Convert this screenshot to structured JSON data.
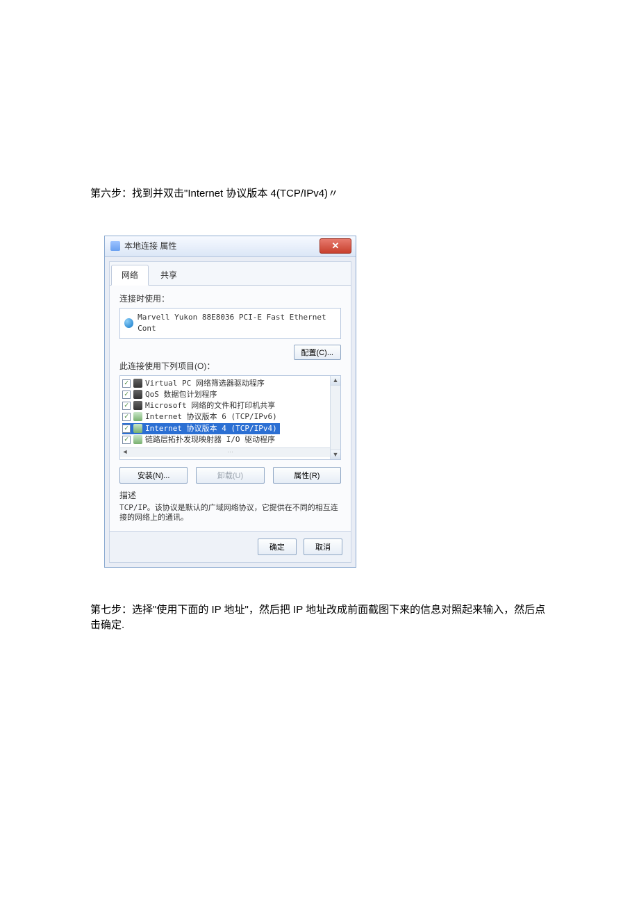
{
  "step6_text": "第六步：找到并双击\"Internet 协议版本 4(TCP/IPv4)〃",
  "step7_text": "第七步：选择\"使用下面的 IP 地址\"，然后把 IP 地址改成前面截图下来的信息对照起来输入，然后点击确定.",
  "dialog": {
    "title": "本地连接 属性",
    "close_label": "✕",
    "tabs": {
      "network": "网络",
      "share": "共享"
    },
    "connect_label": "连接时使用：",
    "adapter": "Marvell Yukon 88E8036 PCI-E Fast Ethernet Cont",
    "configure_btn": "配置(C)...",
    "items_label": "此连接使用下列项目(O)：",
    "items": [
      {
        "label": "Virtual PC 网络筛选器驱动程序",
        "iconClass": "mon",
        "selected": false
      },
      {
        "label": "QoS 数据包计划程序",
        "iconClass": "mon",
        "selected": false
      },
      {
        "label": "Microsoft 网络的文件和打印机共享",
        "iconClass": "mon",
        "selected": false
      },
      {
        "label": "Internet 协议版本 6 (TCP/IPv6)",
        "iconClass": "proto",
        "selected": false
      },
      {
        "label": "Internet 协议版本 4 (TCP/IPv4)",
        "iconClass": "proto",
        "selected": true
      },
      {
        "label": "链路层拓扑发现映射器 I/O 驱动程序",
        "iconClass": "proto",
        "selected": false
      }
    ],
    "install_btn": "安装(N)...",
    "uninstall_btn": "卸载(U)",
    "properties_btn": "属性(R)",
    "desc_label": "描述",
    "desc_body": "TCP/IP。该协议是默认的广域网络协议，它提供在不同的相互连接的网络上的通讯。",
    "ok_btn": "确定",
    "cancel_btn": "取消"
  }
}
